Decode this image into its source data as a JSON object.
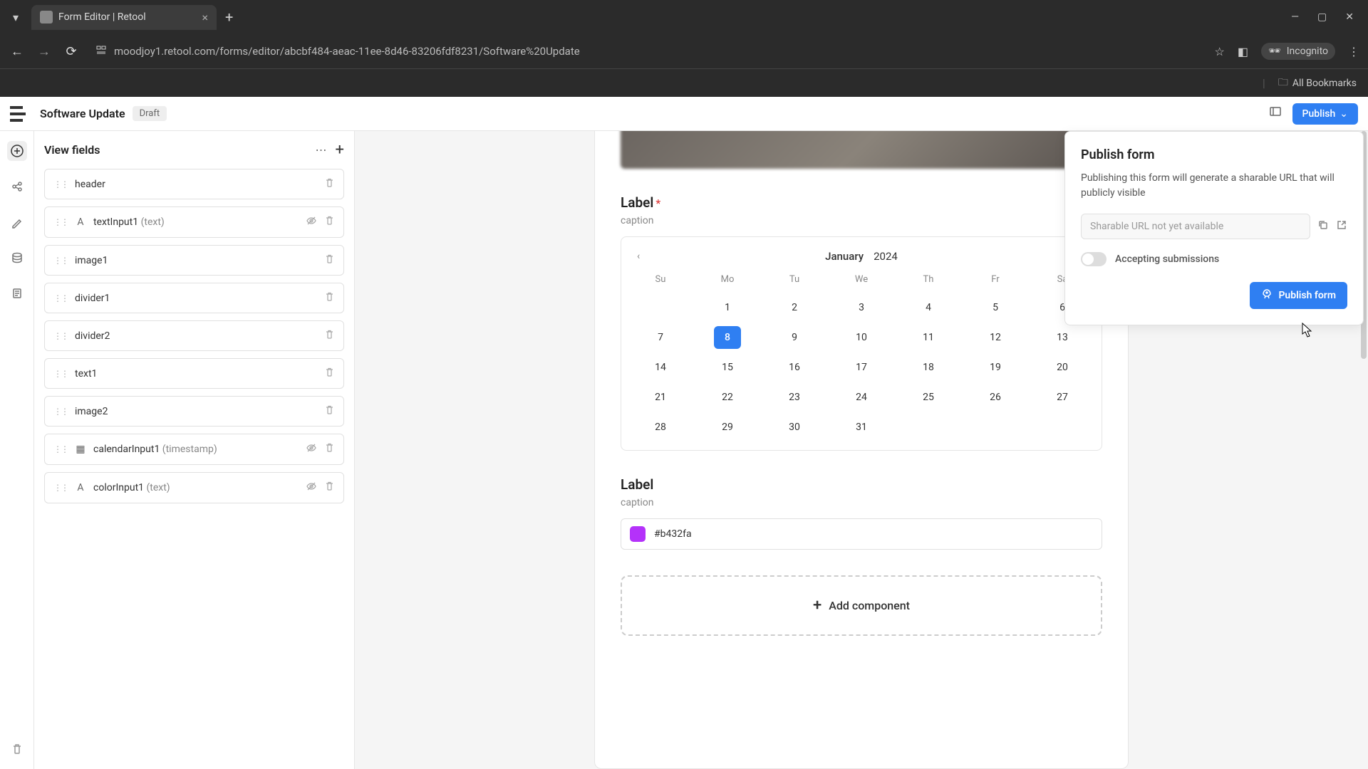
{
  "browser": {
    "tab_title": "Form Editor | Retool",
    "url": "moodjoy1.retool.com/forms/editor/abcbf484-aeac-11ee-8d46-83206fdf8231/Software%20Update",
    "incognito_label": "Incognito",
    "all_bookmarks": "All Bookmarks"
  },
  "header": {
    "title": "Software Update",
    "badge": "Draft",
    "publish_label": "Publish"
  },
  "sidebar": {
    "title": "View fields",
    "fields": [
      {
        "name": "header",
        "type": "",
        "icon": "",
        "hideable": false
      },
      {
        "name": "textInput1",
        "type": "(text)",
        "icon": "A",
        "hideable": true
      },
      {
        "name": "image1",
        "type": "",
        "icon": "",
        "hideable": false
      },
      {
        "name": "divider1",
        "type": "",
        "icon": "",
        "hideable": false
      },
      {
        "name": "divider2",
        "type": "",
        "icon": "",
        "hideable": false
      },
      {
        "name": "text1",
        "type": "",
        "icon": "",
        "hideable": false
      },
      {
        "name": "image2",
        "type": "",
        "icon": "",
        "hideable": false
      },
      {
        "name": "calendarInput1",
        "type": "(timestamp)",
        "icon": "▦",
        "hideable": true
      },
      {
        "name": "colorInput1",
        "type": "(text)",
        "icon": "A",
        "hideable": true
      }
    ]
  },
  "form": {
    "label1": "Label",
    "caption1": "caption",
    "label2": "Label",
    "caption2": "caption",
    "add_component": "Add component",
    "calendar": {
      "month": "January",
      "year": "2024",
      "dow": [
        "Su",
        "Mo",
        "Tu",
        "We",
        "Th",
        "Fr",
        "Sa"
      ],
      "leading_blanks": 1,
      "days_in_month": 31,
      "selected_day": 8
    },
    "color": {
      "value": "#b432fa",
      "swatch": "#b432fa"
    }
  },
  "publish_panel": {
    "title": "Publish form",
    "description": "Publishing this form will generate a sharable URL that will publicly visible",
    "url_placeholder": "Sharable URL not yet available",
    "toggle_label": "Accepting submissions",
    "button_label": "Publish form"
  }
}
